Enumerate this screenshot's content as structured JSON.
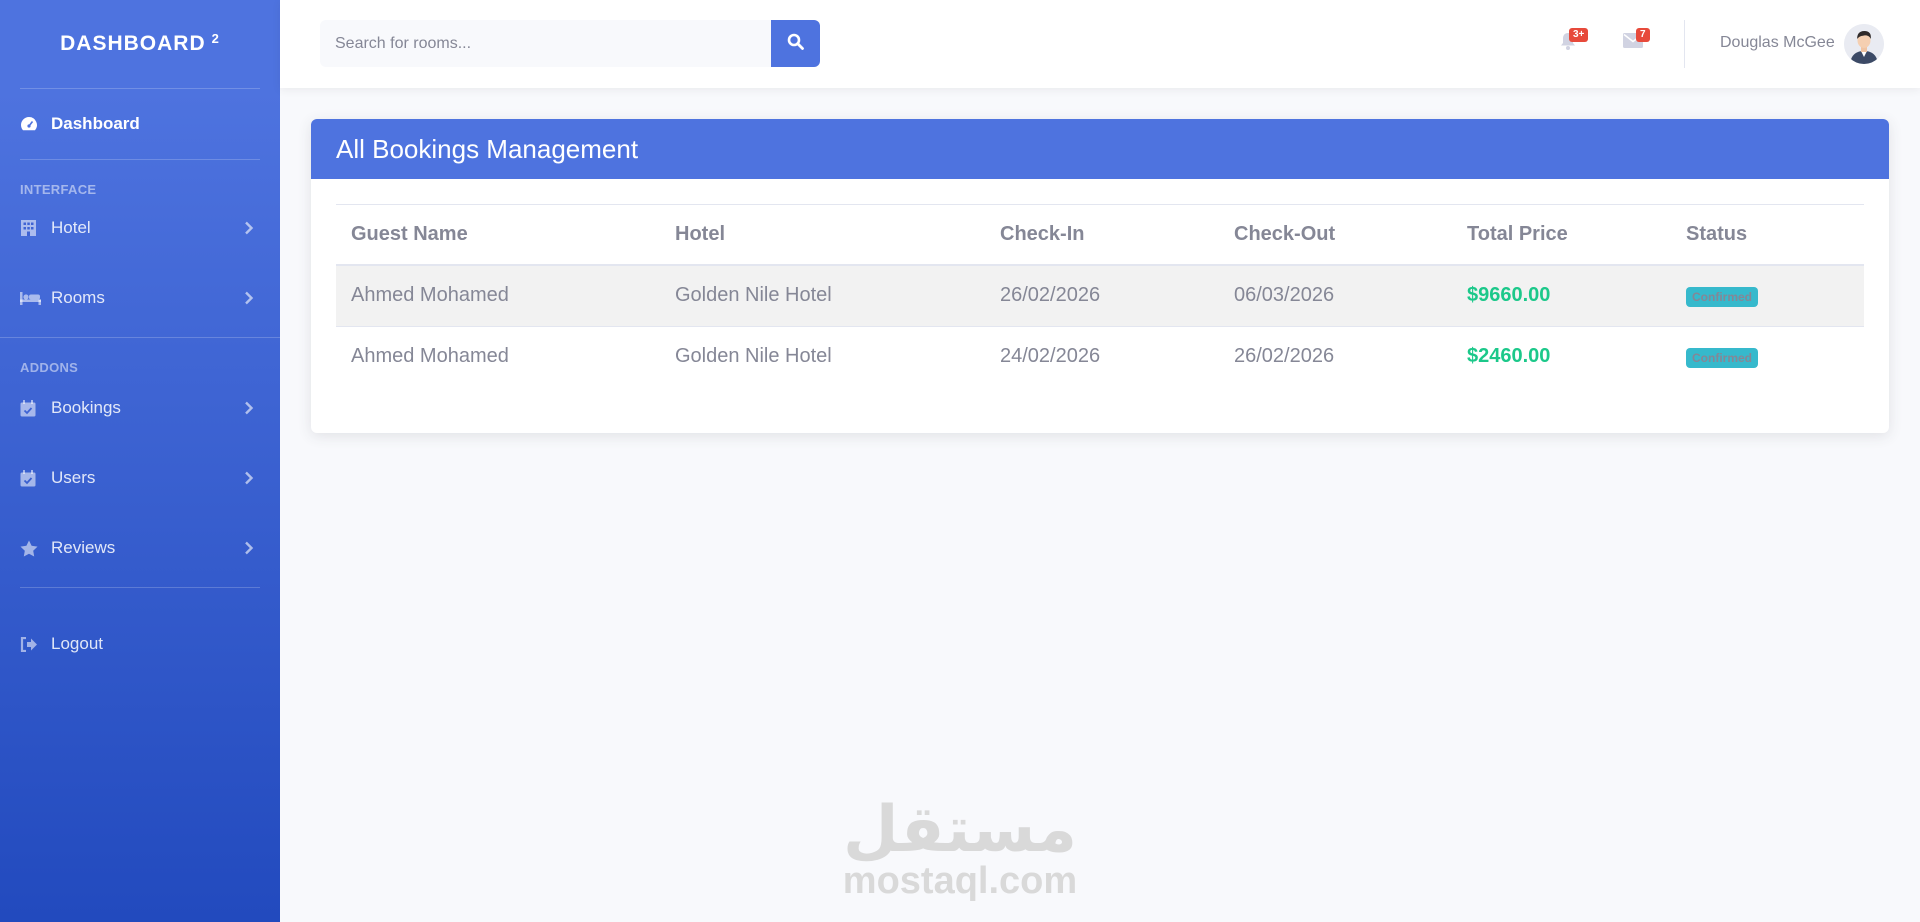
{
  "sidebar": {
    "brand": "DASHBOARD",
    "brand_sup": "2",
    "dashboard_label": "Dashboard",
    "heading_interface": "INTERFACE",
    "heading_addons": "ADDONS",
    "items": [
      {
        "label": "Hotel",
        "icon": "building-icon"
      },
      {
        "label": "Rooms",
        "icon": "bed-icon"
      },
      {
        "label": "Bookings",
        "icon": "calendar-check-icon"
      },
      {
        "label": "Users",
        "icon": "calendar-check-icon"
      },
      {
        "label": "Reviews",
        "icon": "star-icon"
      }
    ],
    "logout_label": "Logout"
  },
  "topbar": {
    "search_placeholder": "Search for rooms...",
    "alerts_count": "3+",
    "messages_count": "7",
    "user_name": "Douglas McGee"
  },
  "card": {
    "title": "All Bookings Management",
    "columns": [
      "Guest Name",
      "Hotel",
      "Check-In",
      "Check-Out",
      "Total Price",
      "Status"
    ],
    "rows": [
      {
        "guest": "Ahmed Mohamed",
        "hotel": "Golden Nile Hotel",
        "check_in": "26/02/2026",
        "check_out": "06/03/2026",
        "price": "$9660.00",
        "status": "Confirmed"
      },
      {
        "guest": "Ahmed Mohamed",
        "hotel": "Golden Nile Hotel",
        "check_in": "24/02/2026",
        "check_out": "26/02/2026",
        "price": "$2460.00",
        "status": "Confirmed"
      }
    ]
  },
  "watermark": {
    "arabic": "مستقل",
    "latin": "mostaql.com"
  },
  "colors": {
    "primary": "#4e73df",
    "success": "#1cc88a",
    "info": "#36b9cc",
    "danger": "#e74a3b"
  }
}
